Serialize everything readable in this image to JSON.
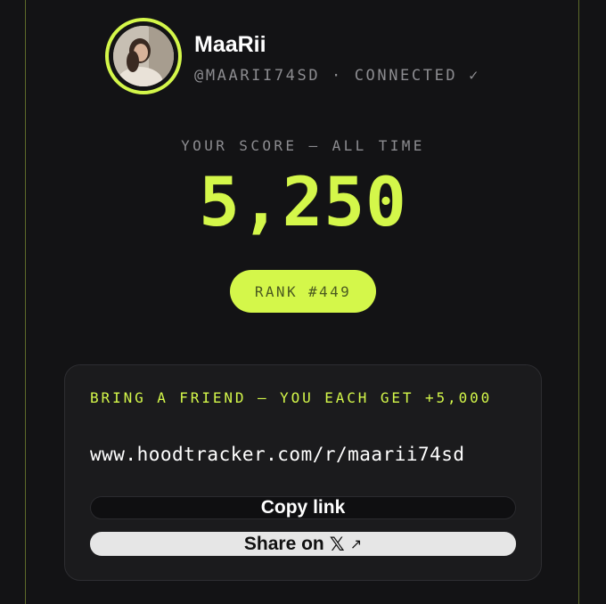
{
  "profile": {
    "name": "MaaRii",
    "handle": "@MAARII74SD",
    "separator": "·",
    "status": "CONNECTED",
    "status_icon": "✓"
  },
  "score": {
    "caption": "YOUR SCORE — ALL TIME",
    "value": "5,250",
    "rank_label": "RANK #449"
  },
  "referral": {
    "title": "BRING A FRIEND — YOU EACH GET +5,000",
    "link": "www.hoodtracker.com/r/maarii74sd",
    "copy_label": "Copy link",
    "share_label": "Share on",
    "share_icon": "𝕏",
    "share_arrow": "↗"
  },
  "colors": {
    "accent": "#d4f74a",
    "background": "#131315",
    "card": "#1b1b1d",
    "muted_text": "#8c8c90"
  }
}
